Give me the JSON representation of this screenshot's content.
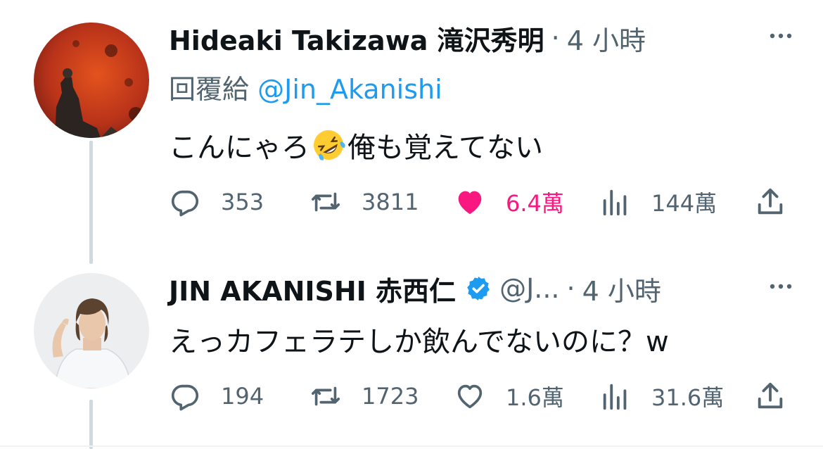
{
  "tweets": [
    {
      "author_name": "Hideaki Takizawa 滝沢秀明",
      "handle": "",
      "separator": "·",
      "time": "4 小時",
      "reply_prefix": "回覆給",
      "reply_to": "@Jin_Akanishi",
      "text_before_emoji": "こんにゃろ",
      "emoji": "rolling-on-floor-laughing-emoji",
      "text_after_emoji": "俺も覚えてない",
      "replies": "353",
      "retweets": "3811",
      "likes": "6.4萬",
      "views": "144萬",
      "liked": true
    },
    {
      "author_name": "JIN AKANISHI 赤西仁",
      "verified": true,
      "handle": "@J...",
      "separator": "·",
      "time": "4 小時",
      "text": "えっカフェラテしか飲んでないのに？w",
      "replies": "194",
      "retweets": "1723",
      "likes": "1.6萬",
      "views": "31.6萬",
      "liked": false
    }
  ],
  "colors": {
    "text_primary": "#0f1419",
    "text_secondary": "#536471",
    "link": "#1d9bf0",
    "like_active": "#f91880",
    "thread_line": "#cfd9de"
  },
  "icons": [
    "more-icon",
    "verified-badge-icon",
    "reply-icon",
    "retweet-icon",
    "like-icon",
    "views-icon",
    "share-icon"
  ]
}
